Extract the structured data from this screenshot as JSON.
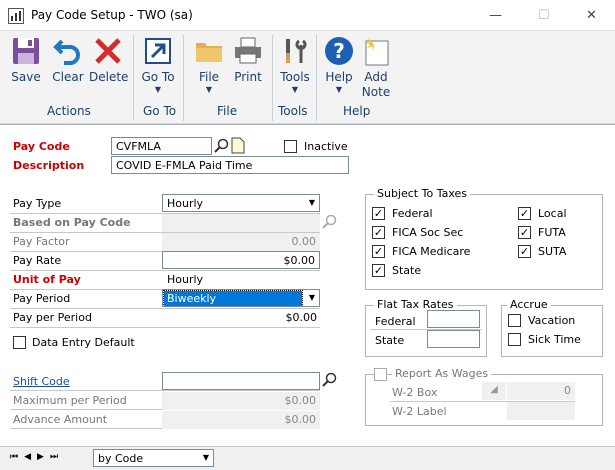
{
  "window": {
    "title": "Pay Code Setup  -  TWO (sa)",
    "minimize": "—",
    "maximize": "☐",
    "close": "✕"
  },
  "ribbon": {
    "save": "Save",
    "clear": "Clear",
    "delete": "Delete",
    "goto": "Go To",
    "file": "File",
    "print": "Print",
    "tools": "Tools",
    "help": "Help",
    "add_note_1": "Add",
    "add_note_2": "Note",
    "groups": {
      "actions": "Actions",
      "goto": "Go To",
      "file": "File",
      "tools": "Tools",
      "help": "Help"
    }
  },
  "form": {
    "pay_code_label": "Pay Code",
    "pay_code_value": "CVFMLA",
    "inactive_label": "Inactive",
    "description_label": "Description",
    "description_value": "COVID E-FMLA Paid Time",
    "pay_type_label": "Pay Type",
    "pay_type_value": "Hourly",
    "based_on_label": "Based on Pay Code",
    "pay_factor_label": "Pay Factor",
    "pay_factor_value": "0.00",
    "pay_rate_label": "Pay Rate",
    "pay_rate_value": "$0.00",
    "unit_of_pay_label": "Unit of Pay",
    "unit_of_pay_value": "Hourly",
    "pay_period_label": "Pay Period",
    "pay_period_value": "Biweekly",
    "pay_per_period_label": "Pay per Period",
    "pay_per_period_value": "$0.00",
    "data_entry_default_label": "Data Entry Default",
    "shift_code_label": "Shift Code",
    "max_per_period_label": "Maximum per Period",
    "max_per_period_value": "$0.00",
    "advance_amount_label": "Advance Amount",
    "advance_amount_value": "$0.00"
  },
  "taxes": {
    "title": "Subject To Taxes",
    "federal": "Federal",
    "fica_soc": "FICA Soc Sec",
    "fica_med": "FICA Medicare",
    "state": "State",
    "local": "Local",
    "futa": "FUTA",
    "suta": "SUTA"
  },
  "flat": {
    "title": "Flat Tax Rates",
    "federal": "Federal",
    "state": "State"
  },
  "accrue": {
    "title": "Accrue",
    "vacation": "Vacation",
    "sick": "Sick Time"
  },
  "wages": {
    "title": "Report As Wages",
    "w2box": "W-2 Box",
    "w2box_value": "0",
    "w2label": "W-2 Label"
  },
  "nav": {
    "sort": "by Code"
  }
}
